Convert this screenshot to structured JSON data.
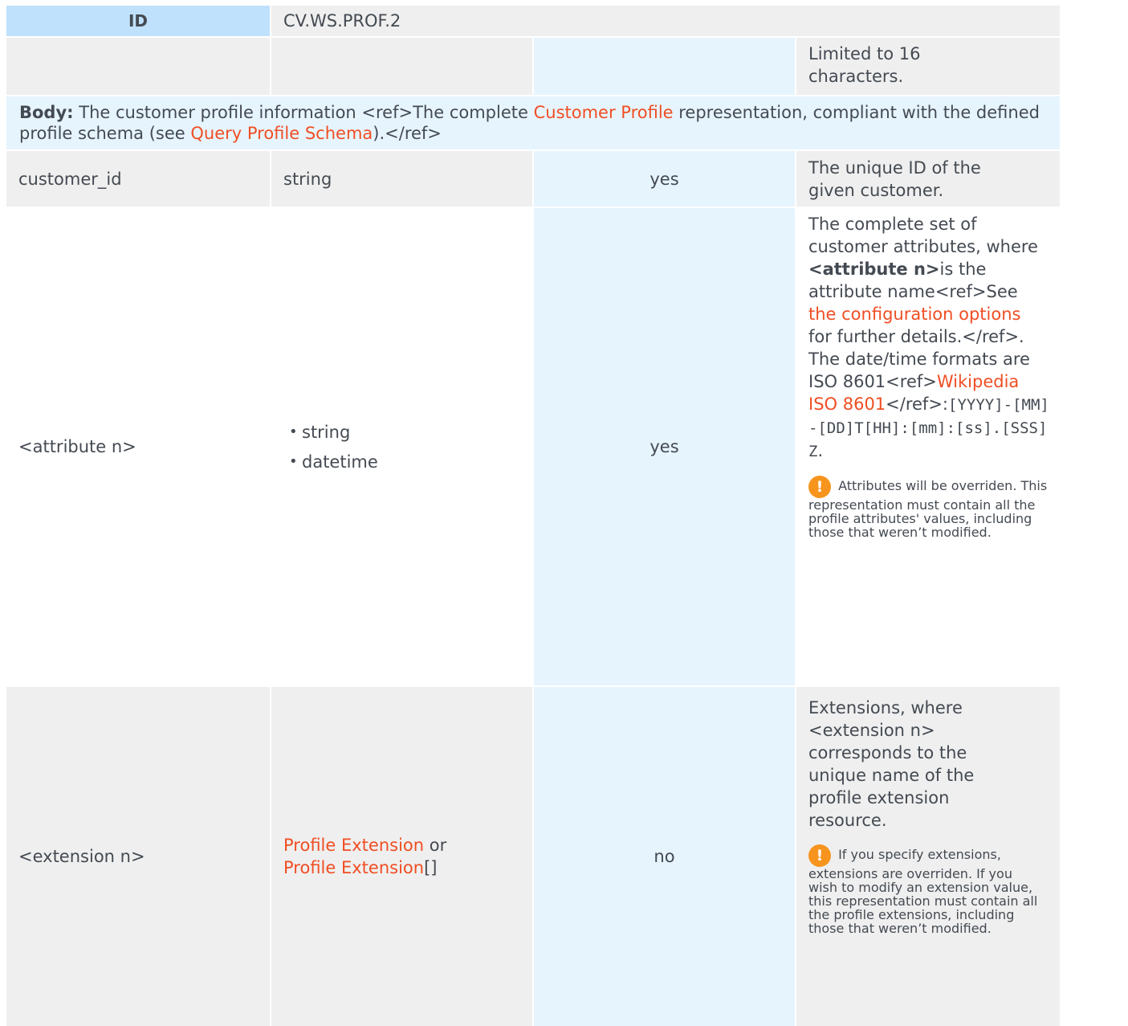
{
  "header": {
    "id_label": "ID",
    "id_value": "CV.WS.PROF.2"
  },
  "limit_row": {
    "note": "Limited to 16 characters."
  },
  "body_row": {
    "label": "Body:",
    "text_1": " The customer profile information <ref>The complete ",
    "link_1": "Customer Profile",
    "text_2": " representation, compliant with the defined profile schema (see ",
    "link_2": "Query Profile Schema",
    "text_3": ").</ref>"
  },
  "rows": {
    "customer_id": {
      "name": "customer_id",
      "type": "string",
      "mandatory": "yes",
      "description": "The unique ID of the given customer."
    },
    "attribute": {
      "name": "<attribute n>",
      "types": [
        "string",
        "datetime"
      ],
      "mandatory": "yes",
      "desc_1": "The complete set of customer attributes, where ",
      "desc_bold": "<attribute n>",
      "desc_2": "is the attribute name<ref>See ",
      "desc_link_1": "the configuration options",
      "desc_3": " for further details.</ref>. The date/time formats are ISO 8601<ref>",
      "desc_link_2": "Wikipedia ISO 8601",
      "desc_4": "</ref>:",
      "desc_mono": "[YYYY]-[MM]-[DD]T[HH]:[mm]:[ss].[SSS]Z",
      "desc_5": ".",
      "warning_icon": "warning-icon",
      "warning": " Attributes will be overriden. This representation must contain all the profile attributes' values, including those that weren’t modified."
    },
    "extension": {
      "name": "<extension n>",
      "type_link_1": "Profile Extension",
      "type_text": " or ",
      "type_link_2": "Profile Extension",
      "type_suffix": "[]",
      "mandatory": "no",
      "description": "Extensions, where <extension n> corresponds to the unique name of the profile extension resource.",
      "warning_icon": "warning-icon",
      "warning": " If you specify extensions, extensions are overriden. If you wish to modify an extension value, this representation must contain all the profile extensions, including those that weren’t modified."
    }
  },
  "colors": {
    "header_bg": "#bfe1fc",
    "gray_bg": "#efefef",
    "blue_bg": "#e6f4fe",
    "link": "#f04e23",
    "warning": "#f7941d"
  }
}
